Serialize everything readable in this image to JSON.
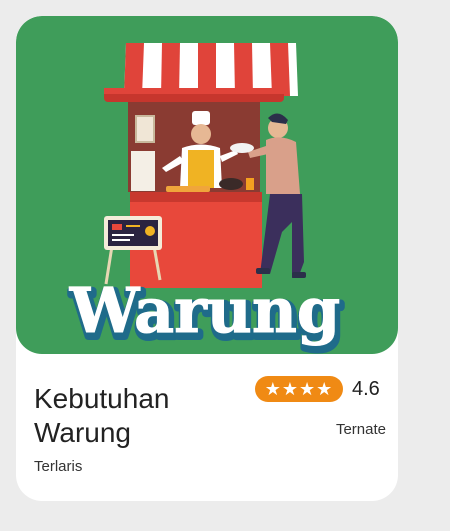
{
  "product": {
    "banner_word": "Warung",
    "title": "Kebutuhan Warung",
    "subtitle": "Terlaris",
    "rating_stars": "★★★★",
    "rating_value": "4.6",
    "location": "Ternate"
  },
  "colors": {
    "banner_bg": "#3f9d5a",
    "rating_pill": "#f08a14",
    "awning_red": "#e0443a",
    "stall_red": "#e8483b"
  },
  "icons": [
    "food-stall-illustration",
    "star-icon"
  ]
}
